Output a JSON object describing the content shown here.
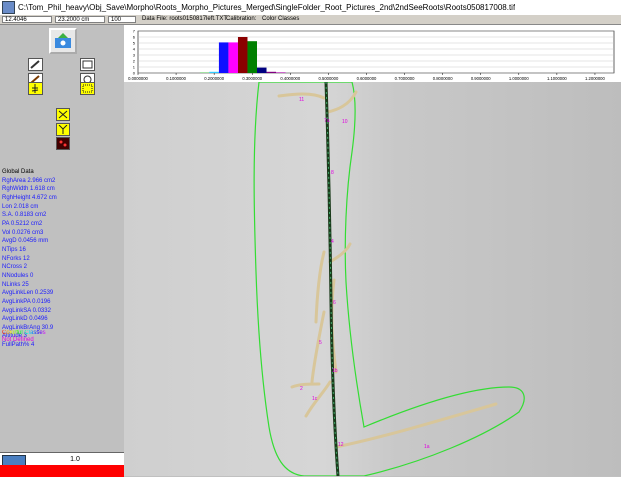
{
  "title": {
    "path": "C:\\Tom_Phil_heavy\\Obj_Save\\Morpho\\Roots_Morpho_Pictures_Merged\\SingleFolder_Root_Pictures_2nd\\2ndSeeRoots\\Roots050817008.tif"
  },
  "infobar": {
    "value1": "12.4046",
    "value2": "23.2000 cm",
    "value3": "100",
    "datafile_label": "Data File: roots0150817left.TXT",
    "calibration_label": "Calibration:",
    "classes_label": "Color Classes"
  },
  "stats": {
    "header": "Global Data",
    "lines": [
      "RghArea 2.966 cm2",
      "RghWidth 1.618 cm",
      "RghHeight 4.672 cm",
      "Lon 2.018 cm",
      "S.A. 0.8183 cm2",
      "PA 0.5212 cm2",
      "Vol 0.0276 cm3",
      "AvgD 0.0456 mm",
      "NTips 16",
      "NForks 12",
      "NCross 2",
      "NNodules 0",
      "NLinks 25",
      "AvgLinkLen 0.2539",
      "AvgLinkPA 0.0196",
      "AvgLinkSA 0.0332",
      "AvgLinkD 0.0496",
      "AvgLinkBrAng 30.9",
      "Altitude 3",
      "FullPath% 4"
    ]
  },
  "legend": {
    "line1": "Colorful Classes",
    "line2": "Not Defined"
  },
  "bottom": {
    "value": "1.0"
  },
  "tip_labels": [
    "11",
    "10",
    "7a",
    "8",
    "4",
    "6",
    "5",
    "1b",
    "1c",
    "2",
    "12",
    "1a"
  ],
  "colors": {
    "stem": "#1a3a1a",
    "roots": "#d8c69a",
    "outline": "#33dd33",
    "tips": "#e000e0",
    "toolYellow": "#ffff00",
    "bottomRed": "#ff0000"
  },
  "chart_data": {
    "type": "bar",
    "categories": [
      "0.0000000",
      "0.1000000",
      "0.2000000",
      "0.3000000",
      "0.4000000",
      "0.5000000",
      "0.6000000",
      "0.7000000",
      "0.8000000",
      "0.9000000",
      "1.0000000",
      "1.1000000",
      "1.2000000"
    ],
    "x_ticks": [
      "0.0000000",
      "0.1000000",
      "0.2000000",
      "0.3000000",
      "0.4000000",
      "0.5000000",
      "0.6000000",
      "0.7000000",
      "0.8000000",
      "0.9000000",
      "1.0000000",
      "1.1000000",
      "1.2000000"
    ],
    "y_ticks": [
      "7",
      "6",
      "5",
      "4",
      "3",
      "2",
      "1",
      "0"
    ],
    "ylim": [
      0,
      7
    ],
    "bars": [
      {
        "x": 0.175,
        "value": 0.1,
        "color": "#66cc66"
      },
      {
        "x": 0.2,
        "value": 0.2,
        "color": "#33ccff"
      },
      {
        "x": 0.225,
        "value": 5.1,
        "color": "#1010ff"
      },
      {
        "x": 0.25,
        "value": 5.1,
        "color": "#ff00ff"
      },
      {
        "x": 0.275,
        "value": 6.0,
        "color": "#8b0000"
      },
      {
        "x": 0.3,
        "value": 5.3,
        "color": "#008000"
      },
      {
        "x": 0.325,
        "value": 0.9,
        "color": "#000080"
      },
      {
        "x": 0.35,
        "value": 0.2,
        "color": "#800080"
      },
      {
        "x": 0.375,
        "value": 0.1,
        "color": "#aa00aa"
      }
    ],
    "title": "",
    "xlabel": "",
    "ylabel": ""
  }
}
